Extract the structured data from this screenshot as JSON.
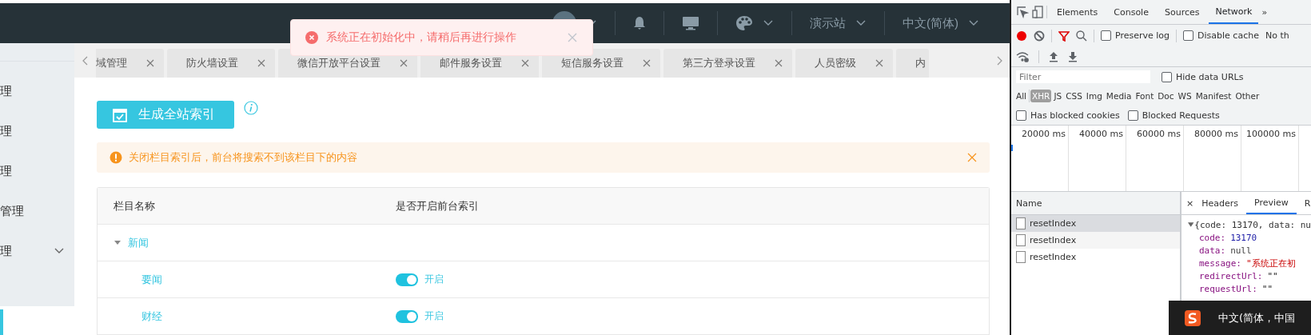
{
  "header": {
    "site": "演示站",
    "language": "中文(简体)"
  },
  "toast": {
    "message": "系统正在初始化中，请稍后再进行操作"
  },
  "sidebar": {
    "items": [
      {
        "label": "理",
        "kind": "link"
      },
      {
        "label": "理",
        "kind": "link"
      },
      {
        "label": "理",
        "kind": "link"
      },
      {
        "label": "管理",
        "kind": "link"
      },
      {
        "label": "理",
        "kind": "submenu"
      }
    ]
  },
  "tabs": [
    {
      "label": "域管理",
      "selected": false
    },
    {
      "label": "防火墙设置",
      "selected": false
    },
    {
      "label": "微信开放平台设置",
      "selected": false
    },
    {
      "label": "邮件服务设置",
      "selected": false
    },
    {
      "label": "短信服务设置",
      "selected": false
    },
    {
      "label": "第三方登录设置",
      "selected": false
    },
    {
      "label": "人员密级",
      "selected": false
    },
    {
      "label": "内",
      "selected": false
    }
  ],
  "page": {
    "generate_button": "生成全站索引",
    "alert": "关闭栏目索引后，前台将搜索不到该栏目下的内容",
    "table": {
      "columns": [
        "栏目名称",
        "是否开启前台索引"
      ],
      "rows": [
        {
          "kind": "group",
          "name": "新闻",
          "expanded": true
        },
        {
          "kind": "item",
          "name": "要闻",
          "on": true,
          "status": "开启"
        },
        {
          "kind": "item",
          "name": "财经",
          "on": true,
          "status": "开启"
        }
      ]
    }
  },
  "devtools": {
    "panels": [
      {
        "label": "Elements",
        "selected": false
      },
      {
        "label": "Console",
        "selected": false
      },
      {
        "label": "Sources",
        "selected": false
      },
      {
        "label": "Network",
        "selected": true
      }
    ],
    "more_tabs": "»",
    "recording": true,
    "options": [
      {
        "label": "Preserve log",
        "checked": false
      },
      {
        "label": "Disable cache",
        "checked": false
      }
    ],
    "throttling": "No th",
    "filter": {
      "placeholder": "Filter"
    },
    "hide_data_urls": {
      "label": "Hide data URLs",
      "checked": false
    },
    "types": [
      {
        "label": "All",
        "selected": false
      },
      {
        "label": "XHR",
        "selected": true
      },
      {
        "label": "JS",
        "selected": false
      },
      {
        "label": "CSS",
        "selected": false
      },
      {
        "label": "Img",
        "selected": false
      },
      {
        "label": "Media",
        "selected": false
      },
      {
        "label": "Font",
        "selected": false
      },
      {
        "label": "Doc",
        "selected": false
      },
      {
        "label": "WS",
        "selected": false
      },
      {
        "label": "Manifest",
        "selected": false
      },
      {
        "label": "Other",
        "selected": false
      }
    ],
    "blocked": [
      {
        "label": "Has blocked cookies",
        "checked": false
      },
      {
        "label": "Blocked Requests",
        "checked": false
      }
    ],
    "timeline": {
      "ticks": [
        "20000 ms",
        "40000 ms",
        "60000 ms",
        "80000 ms",
        "100000 ms"
      ]
    },
    "requests": {
      "column": "Name",
      "rows": [
        {
          "name": "resetIndex",
          "selected": true
        },
        {
          "name": "resetIndex",
          "selected": false
        },
        {
          "name": "resetIndex",
          "selected": false
        }
      ]
    },
    "details": {
      "close": "×",
      "tabs": [
        {
          "label": "Headers",
          "selected": false
        },
        {
          "label": "Preview",
          "selected": true
        },
        {
          "label": "R",
          "selected": false
        }
      ],
      "preview": {
        "summary": "{code: 13170, data: nu",
        "expanded": true,
        "fields": [
          {
            "key": "code:",
            "value": "13170",
            "kind": "number"
          },
          {
            "key": "data:",
            "value": "null",
            "kind": "null"
          },
          {
            "key": "message:",
            "value": "\"系统正在初",
            "kind": "string"
          },
          {
            "key": "redirectUrl:",
            "value": "\"\"",
            "kind": "empty"
          },
          {
            "key": "requestUrl:",
            "value": "\"\"",
            "kind": "empty"
          }
        ]
      }
    }
  },
  "ime": {
    "text": "中文(简体，中国"
  }
}
